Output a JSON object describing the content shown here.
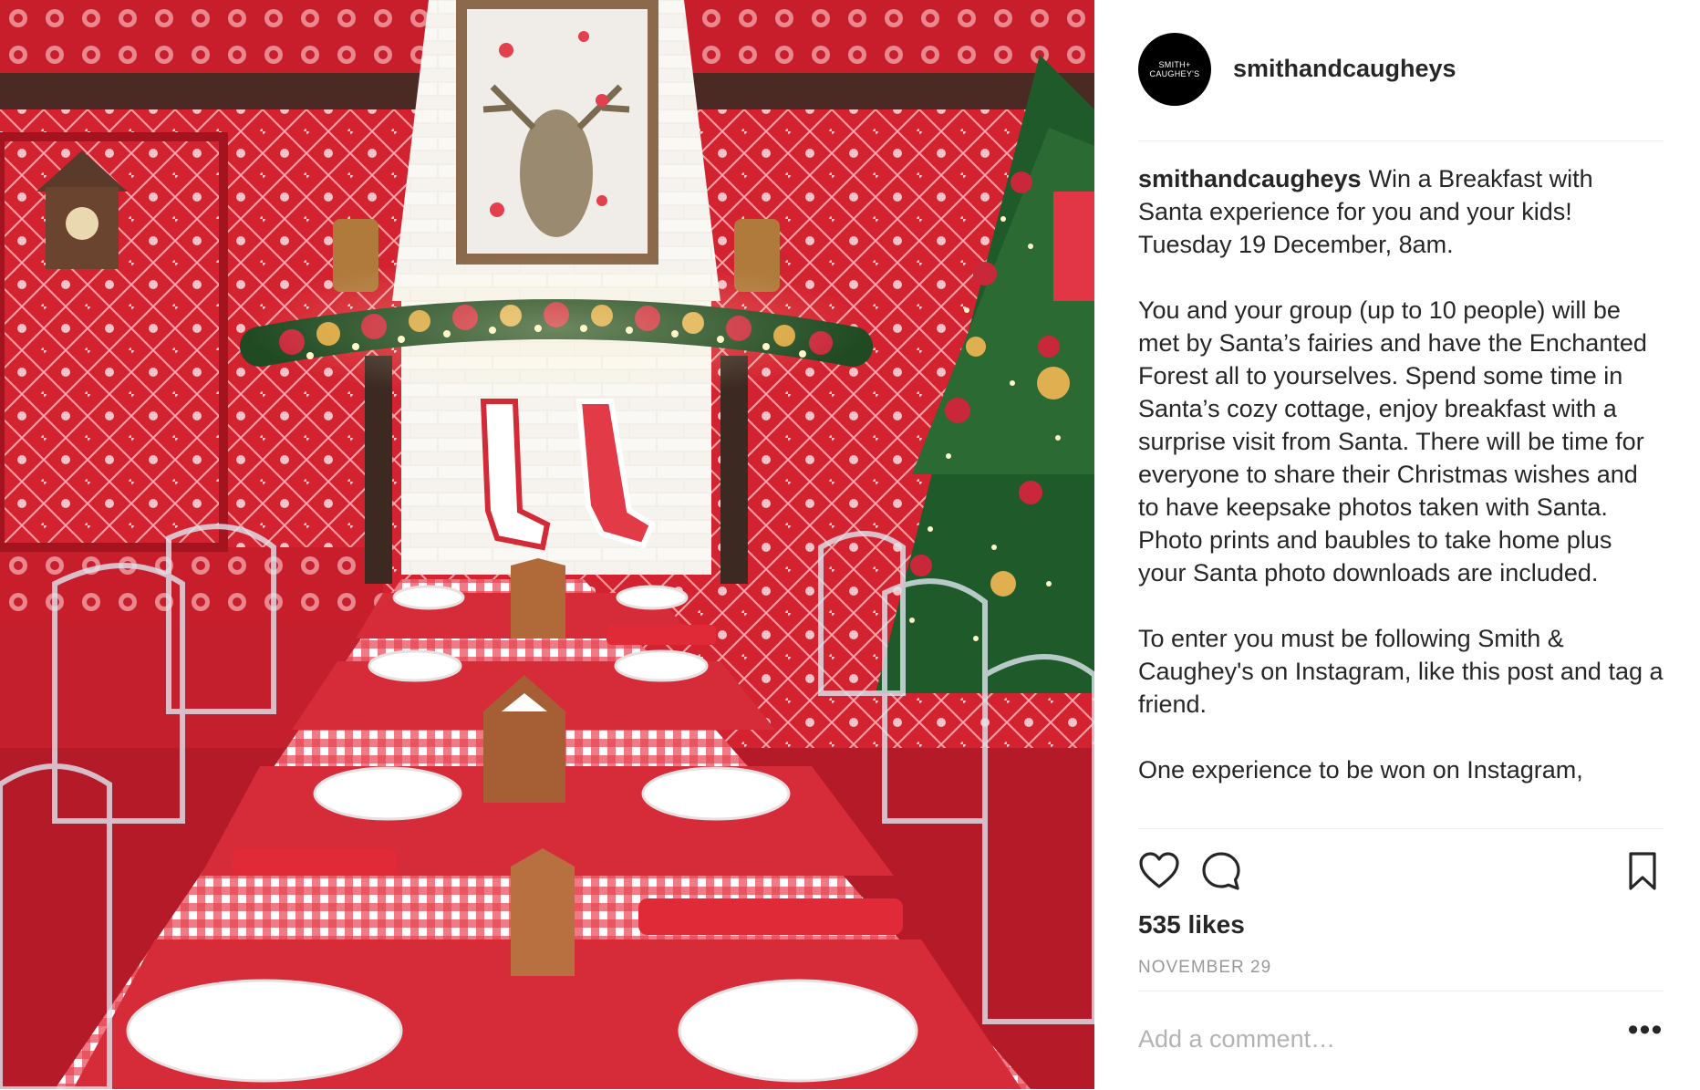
{
  "header": {
    "avatar_text_line1": "SMITH+",
    "avatar_text_line2": "CAUGHEY'S",
    "username": "smithandcaugheys"
  },
  "caption": {
    "username": "smithandcaugheys",
    "paragraphs": [
      "Win a Breakfast with Santa experience for you and your kids! Tuesday 19 December, 8am.",
      "You and your group (up to 10 people) will be met by Santa’s fairies and have the Enchanted Forest all to yourselves. Spend some time in Santa’s cozy cottage, enjoy breakfast with a surprise visit from Santa. There will be time for everyone to share their Christmas wishes and to have keepsake photos taken with Santa. Photo prints and baubles to take home plus your Santa photo downloads are included.",
      "To enter you must be following Smith & Caughey's on Instagram, like this post and tag a friend.",
      "One experience to be won on Instagram,"
    ]
  },
  "actions": {
    "like_icon": "heart-outline-icon",
    "comment_icon": "speech-bubble-icon",
    "save_icon": "bookmark-icon"
  },
  "likes": "535 likes",
  "date": "NOVEMBER 29",
  "comment": {
    "placeholder": "Add a comment…",
    "more_label": "•••"
  },
  "colors": {
    "wallpaper_red": "#d4202e",
    "text_primary": "#262626",
    "text_muted": "#999999",
    "divider": "#efefef"
  }
}
